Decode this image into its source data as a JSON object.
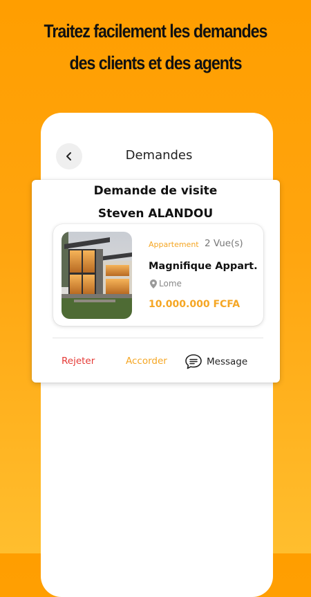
{
  "promo": {
    "line1": "Traitez facilement les demandes",
    "line2": "des clients et des agents"
  },
  "header": {
    "title": "Demandes",
    "back_icon": "chevron-left-icon"
  },
  "request": {
    "type": "Demande de visite",
    "client_name": "Steven ALANDOU"
  },
  "property": {
    "category": "Appartement",
    "views": "2 Vue(s)",
    "title": "Magnifique Appart.",
    "location": "Lome",
    "price": "10.000.000 FCFA"
  },
  "actions": {
    "reject": "Rejeter",
    "accept": "Accorder",
    "message": "Message"
  },
  "colors": {
    "accent": "#F5A623",
    "reject": "#E53935",
    "background": "#FFA50F"
  }
}
